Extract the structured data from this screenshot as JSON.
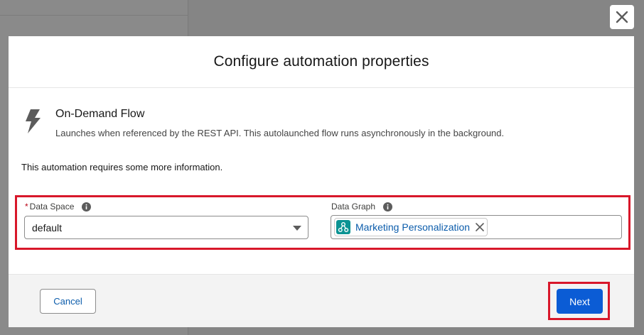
{
  "modal": {
    "title": "Configure automation properties",
    "close_icon": "close-icon"
  },
  "flow": {
    "icon": "lightning-bolt-icon",
    "name": "On-Demand Flow",
    "description": "Launches when referenced by the REST API. This autolaunched flow runs asynchronously in the background."
  },
  "info_message": "This automation requires some more information.",
  "fields": {
    "data_space": {
      "required_marker": "*",
      "label": "Data Space",
      "value": "default",
      "info_icon": "info-icon"
    },
    "data_graph": {
      "label": "Data Graph",
      "selected_pill": "Marketing Personalization",
      "pill_icon": "data-graph-icon",
      "info_icon": "info-icon"
    }
  },
  "footer": {
    "cancel_label": "Cancel",
    "next_label": "Next"
  },
  "colors": {
    "brand_button": "#0b5cd5",
    "link": "#0b5cab",
    "highlight": "#d8172a",
    "pill_icon_bg": "#0b9393"
  }
}
